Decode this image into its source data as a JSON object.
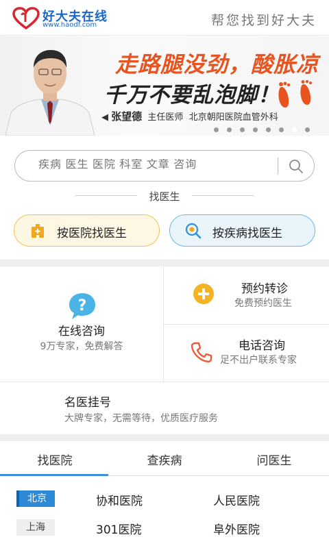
{
  "header": {
    "logo_name": "好大夫在线",
    "logo_url": "www.haodf.com",
    "slogan": "帮您找到好大夫"
  },
  "banner": {
    "headline": "走路腿没劲，酸胀凉",
    "subline": "千万不要乱泡脚！",
    "doctor_name": "张望德",
    "doctor_title": "主任医师",
    "doctor_hospital": "北京朝阳医院血管外科",
    "slide_count": 8,
    "active_slide": 7
  },
  "search": {
    "placeholder": "疾病 医生 医院 科室 文章 咨询"
  },
  "find_doctor": {
    "title": "找医生",
    "by_hospital": "按医院找医生",
    "by_disease": "按疾病找医生"
  },
  "services": {
    "online": {
      "title": "在线咨询",
      "desc": "9万专家，免费解答"
    },
    "referral": {
      "title": "预约转诊",
      "desc": "免费预约医生"
    },
    "phone": {
      "title": "电话咨询",
      "desc": "足不出户联系专家"
    },
    "famous": {
      "title": "名医挂号",
      "desc": "大牌专家，无需等待，优质医疗服务"
    }
  },
  "tabs": [
    "找医院",
    "查疾病",
    "问医生"
  ],
  "cities": [
    {
      "name": "北京",
      "hospitals": [
        "协和医院",
        "人民医院"
      ]
    },
    {
      "name": "上海",
      "hospitals": [
        "301医院",
        "阜外医院"
      ]
    }
  ],
  "colors": {
    "brand_blue": "#1a66c9",
    "accent_red": "#e8531f",
    "tab_active": "#3a8fd8",
    "hospital_pill": "#f0c24c",
    "disease_pill": "#6bb8e6"
  }
}
